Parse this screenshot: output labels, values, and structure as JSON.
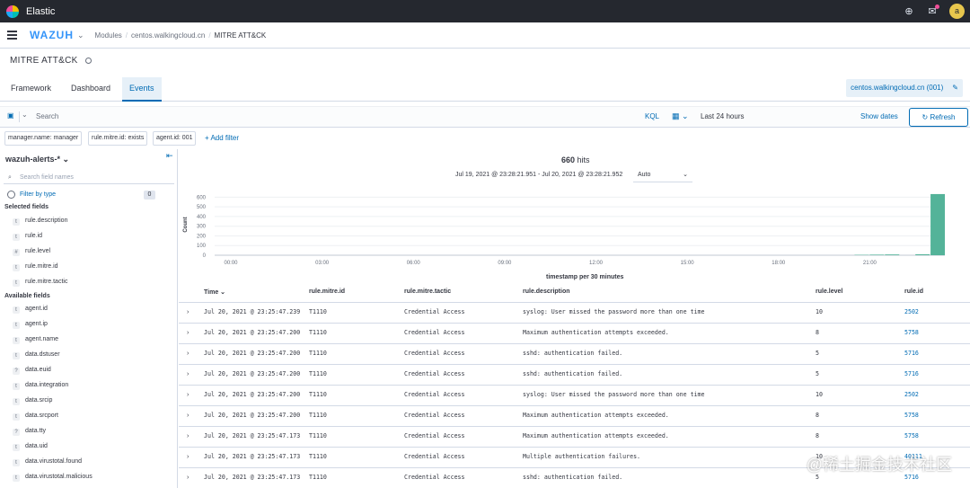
{
  "topbar": {
    "title": "Elastic",
    "avatar": "a",
    "colors": {
      "bg": "#25282f",
      "accent": "#006bb4"
    }
  },
  "nav": {
    "logo": "WAZUH",
    "breadcrumbs": [
      "Modules",
      "centos.walkingcloud.cn",
      "MITRE ATT&CK"
    ]
  },
  "page": {
    "title": "MITRE ATT&CK"
  },
  "tabs": [
    {
      "label": "Framework"
    },
    {
      "label": "Dashboard"
    },
    {
      "label": "Events",
      "active": true
    }
  ],
  "agent": {
    "label": "centos.walkingcloud.cn (001)"
  },
  "search": {
    "placeholder": "Search",
    "kql": "KQL",
    "time": "Last 24 hours",
    "show_dates": "Show dates",
    "refresh": "Refresh"
  },
  "filters": {
    "pills": [
      "manager.name: manager",
      "rule.mitre.id: exists",
      "agent.id: 001"
    ],
    "add": "+ Add filter"
  },
  "sidebar": {
    "index_pattern": "wazuh-alerts-*",
    "search_placeholder": "Search field names",
    "filter_by_type": "Filter by type",
    "filter_count": "0",
    "selected_header": "Selected fields",
    "selected_fields": [
      {
        "type": "t",
        "name": "rule.description"
      },
      {
        "type": "t",
        "name": "rule.id"
      },
      {
        "type": "#",
        "name": "rule.level"
      },
      {
        "type": "t",
        "name": "rule.mitre.id"
      },
      {
        "type": "t",
        "name": "rule.mitre.tactic"
      }
    ],
    "available_header": "Available fields",
    "available_fields": [
      {
        "type": "t",
        "name": "agent.id"
      },
      {
        "type": "t",
        "name": "agent.ip"
      },
      {
        "type": "t",
        "name": "agent.name"
      },
      {
        "type": "t",
        "name": "data.dstuser"
      },
      {
        "type": "?",
        "name": "data.euid"
      },
      {
        "type": "t",
        "name": "data.integration"
      },
      {
        "type": "t",
        "name": "data.srcip"
      },
      {
        "type": "t",
        "name": "data.srcport"
      },
      {
        "type": "?",
        "name": "data.tty"
      },
      {
        "type": "t",
        "name": "data.uid"
      },
      {
        "type": "t",
        "name": "data.virustotal.found"
      },
      {
        "type": "t",
        "name": "data.virustotal.malicious"
      }
    ]
  },
  "main": {
    "hits_count": "660",
    "hits_label": "hits",
    "date_range": "Jul 19, 2021 @ 23:28:21.951 - Jul 20, 2021 @ 23:28:21.952",
    "interval": "Auto"
  },
  "chart_data": {
    "type": "bar",
    "ylabel": "Count",
    "xlabel": "timestamp per 30 minutes",
    "yticks": [
      0,
      100,
      200,
      300,
      400,
      500,
      600
    ],
    "ylim": [
      0,
      650
    ],
    "xticks": [
      "00:00",
      "03:00",
      "06:00",
      "09:00",
      "12:00",
      "15:00",
      "18:00",
      "21:00"
    ],
    "bar_color": "#54b399",
    "series": [
      {
        "values": [
          4,
          6,
          8,
          10,
          632
        ]
      }
    ],
    "bar_bins_hours_after_midnight": [
      20.5,
      21.0,
      21.5,
      22.5,
      23.0
    ]
  },
  "table": {
    "columns": [
      "Time",
      "rule.mitre.id",
      "rule.mitre.tactic",
      "rule.description",
      "rule.level",
      "rule.id"
    ],
    "rows": [
      [
        "Jul 20, 2021 @ 23:25:47.239",
        "T1110",
        "Credential Access",
        "syslog: User missed the password more than one time",
        "10",
        "2502"
      ],
      [
        "Jul 20, 2021 @ 23:25:47.200",
        "T1110",
        "Credential Access",
        "Maximum authentication attempts exceeded.",
        "8",
        "5758"
      ],
      [
        "Jul 20, 2021 @ 23:25:47.200",
        "T1110",
        "Credential Access",
        "sshd: authentication failed.",
        "5",
        "5716"
      ],
      [
        "Jul 20, 2021 @ 23:25:47.200",
        "T1110",
        "Credential Access",
        "sshd: authentication failed.",
        "5",
        "5716"
      ],
      [
        "Jul 20, 2021 @ 23:25:47.200",
        "T1110",
        "Credential Access",
        "syslog: User missed the password more than one time",
        "10",
        "2502"
      ],
      [
        "Jul 20, 2021 @ 23:25:47.200",
        "T1110",
        "Credential Access",
        "Maximum authentication attempts exceeded.",
        "8",
        "5758"
      ],
      [
        "Jul 20, 2021 @ 23:25:47.173",
        "T1110",
        "Credential Access",
        "Maximum authentication attempts exceeded.",
        "8",
        "5758"
      ],
      [
        "Jul 20, 2021 @ 23:25:47.173",
        "T1110",
        "Credential Access",
        "Multiple authentication failures.",
        "10",
        "40111"
      ],
      [
        "Jul 20, 2021 @ 23:25:47.173",
        "T1110",
        "Credential Access",
        "sshd: authentication failed.",
        "5",
        "5716"
      ]
    ]
  },
  "watermark": "@稀土掘金技术社区"
}
